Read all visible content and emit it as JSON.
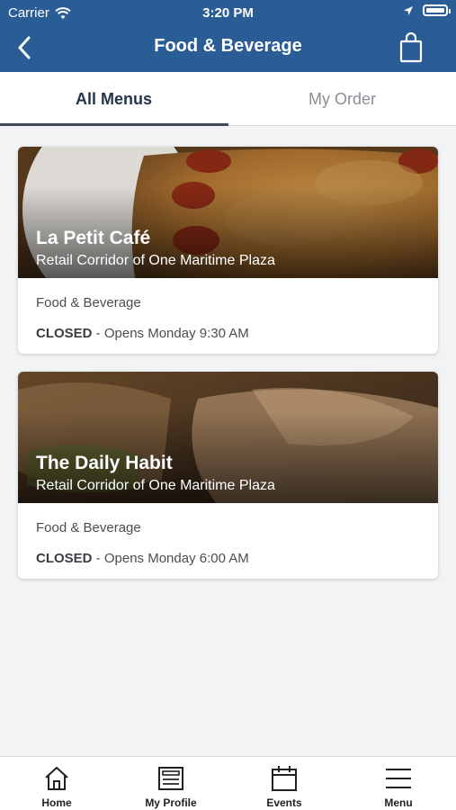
{
  "status_bar": {
    "carrier": "Carrier",
    "time": "3:20 PM"
  },
  "header": {
    "title": "Food & Beverage"
  },
  "tabs": [
    {
      "label": "All Menus",
      "active": true
    },
    {
      "label": "My Order",
      "active": false
    }
  ],
  "venues": [
    {
      "name": "La Petit Café",
      "location": "Retail Corridor of One Maritime Plaza",
      "category": "Food & Beverage",
      "status": "CLOSED",
      "hours": " - Opens Monday 9:30 AM"
    },
    {
      "name": "The Daily Habit",
      "location": "Retail Corridor of One Maritime Plaza",
      "category": "Food & Beverage",
      "status": "CLOSED",
      "hours": " - Opens Monday 6:00 AM"
    }
  ],
  "bottom_nav": [
    {
      "label": "Home",
      "icon": "home-icon"
    },
    {
      "label": "My Profile",
      "icon": "profile-icon"
    },
    {
      "label": "Events",
      "icon": "calendar-icon"
    },
    {
      "label": "Menu",
      "icon": "hamburger-icon"
    }
  ],
  "colors": {
    "header_bg": "#2a5d96",
    "page_bg": "#f2f3f5",
    "active_tab": "#24364d"
  }
}
